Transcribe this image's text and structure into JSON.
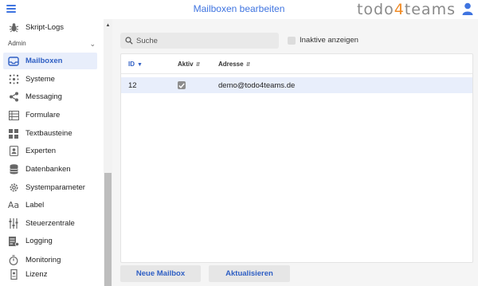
{
  "header": {
    "title": "Mailboxen bearbeiten",
    "logo_pre": "todo",
    "logo_accent": "4",
    "logo_post": "teams"
  },
  "sidebar": {
    "items": [
      {
        "label": "Skript-Logs"
      },
      {
        "label": "Mailboxen"
      },
      {
        "label": "Systeme"
      },
      {
        "label": "Messaging"
      },
      {
        "label": "Formulare"
      },
      {
        "label": "Textbausteine"
      },
      {
        "label": "Experten"
      },
      {
        "label": "Datenbanken"
      },
      {
        "label": "Systemparameter"
      },
      {
        "label": "Label"
      },
      {
        "label": "Steuerzentrale"
      },
      {
        "label": "Logging"
      },
      {
        "label": "Monitoring"
      },
      {
        "label": "Lizenz"
      }
    ],
    "section": "Admin"
  },
  "main": {
    "search_placeholder": "Suche",
    "inactive_label": "Inaktive anzeigen",
    "inactive_checked": false,
    "columns": [
      "ID",
      "Aktiv",
      "Adresse"
    ],
    "rows": [
      {
        "id": "12",
        "active": true,
        "address": "demo@todo4teams.de"
      }
    ],
    "buttons": {
      "new": "Neue Mailbox",
      "refresh": "Aktualisieren"
    }
  },
  "colors": {
    "accent": "#3f74e0",
    "logo_accent": "#f08a24",
    "selection": "#e8eefb"
  }
}
